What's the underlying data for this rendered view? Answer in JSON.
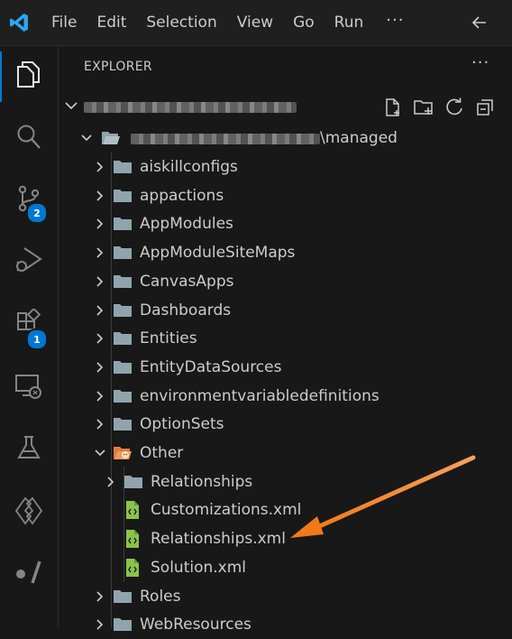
{
  "menubar": {
    "items": [
      "File",
      "Edit",
      "Selection",
      "View",
      "Go",
      "Run"
    ],
    "more": "···"
  },
  "activity": {
    "items": [
      {
        "name": "explorer",
        "icon": "files-icon"
      },
      {
        "name": "search",
        "icon": "search-icon"
      },
      {
        "name": "source-control",
        "icon": "source-control-icon",
        "badge": "2"
      },
      {
        "name": "run-debug",
        "icon": "run-debug-icon"
      },
      {
        "name": "extensions",
        "icon": "extensions-icon",
        "badge": "1"
      },
      {
        "name": "remote-explorer",
        "icon": "remote-explorer-icon"
      },
      {
        "name": "testing",
        "icon": "flask-icon"
      },
      {
        "name": "power-platform",
        "icon": "power-platform-icon"
      },
      {
        "name": "power-platform-cli",
        "icon": "slash-dot-icon"
      }
    ]
  },
  "explorer": {
    "title": "EXPLORER",
    "more": "···",
    "root_folder_suffix": "\\managed",
    "tree": [
      {
        "label": "aiskillconfigs",
        "type": "folder",
        "expanded": false
      },
      {
        "label": "appactions",
        "type": "folder",
        "expanded": false
      },
      {
        "label": "AppModules",
        "type": "folder",
        "expanded": false
      },
      {
        "label": "AppModuleSiteMaps",
        "type": "folder",
        "expanded": false
      },
      {
        "label": "CanvasApps",
        "type": "folder",
        "expanded": false
      },
      {
        "label": "Dashboards",
        "type": "folder",
        "expanded": false
      },
      {
        "label": "Entities",
        "type": "folder",
        "expanded": false
      },
      {
        "label": "EntityDataSources",
        "type": "folder",
        "expanded": false
      },
      {
        "label": "environmentvariabledefinitions",
        "type": "folder",
        "expanded": false
      },
      {
        "label": "OptionSets",
        "type": "folder",
        "expanded": false
      },
      {
        "label": "Other",
        "type": "folder-open",
        "expanded": true
      },
      {
        "label": "Relationships",
        "type": "folder",
        "expanded": false
      },
      {
        "label": "Customizations.xml",
        "type": "xml-file"
      },
      {
        "label": "Relationships.xml",
        "type": "xml-file"
      },
      {
        "label": "Solution.xml",
        "type": "xml-file"
      },
      {
        "label": "Roles",
        "type": "folder",
        "expanded": false
      },
      {
        "label": "WebResources",
        "type": "folder",
        "expanded": false
      }
    ]
  },
  "colors": {
    "accent": "#0078d4",
    "folder": "#90a4ae",
    "xml_file": "#8bc34a",
    "annotation_arrow": "#f0832a"
  }
}
